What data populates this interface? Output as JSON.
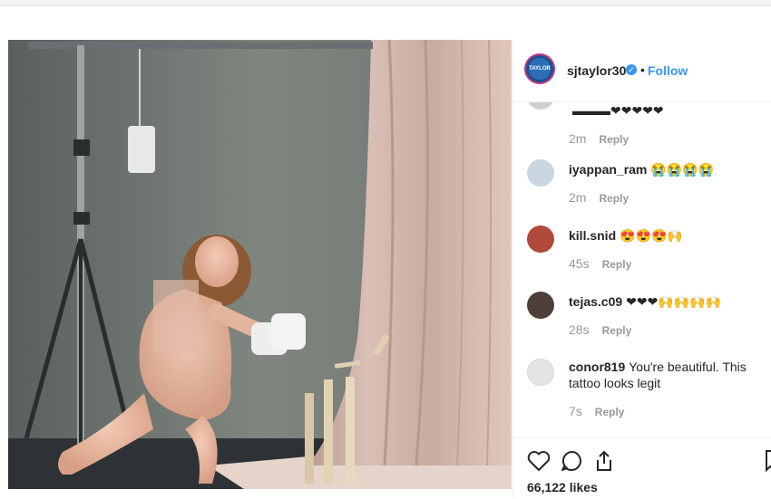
{
  "post": {
    "username": "sjtaylor30",
    "verified_badge": "✓",
    "separator": "•",
    "follow_label": "Follow",
    "more_label": "⋮",
    "avatar_text": "TAYLOR",
    "likes": "66,122 likes"
  },
  "comments": [
    {
      "username": "",
      "text": "▬▬▬❤❤❤❤❤",
      "time": "2m",
      "reply": "Reply"
    },
    {
      "username": "iyappan_ram",
      "text": "😭😭😭😭",
      "time": "2m",
      "reply": "Reply"
    },
    {
      "username": "kill.snid",
      "text": "😍😍😍🙌",
      "time": "45s",
      "reply": "Reply"
    },
    {
      "username": "tejas.c09",
      "text": "❤❤❤🙌🙌🙌🙌",
      "time": "28s",
      "reply": "Reply"
    },
    {
      "username": "conor819",
      "text": "You're beautiful. This tattoo looks legit",
      "time": "7s",
      "reply": "Reply"
    }
  ],
  "icons": {
    "like": "heart-icon",
    "comment": "comment-icon",
    "share": "share-icon",
    "save": "bookmark-icon"
  },
  "colors": {
    "follow": "#3897f0",
    "verified": "#3897f0",
    "text": "#262626",
    "muted": "#999999"
  }
}
